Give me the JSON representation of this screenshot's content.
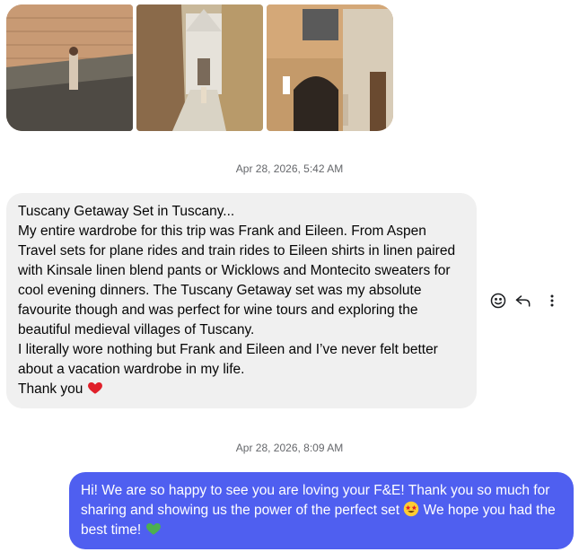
{
  "photos": [
    {
      "name": "photo-stone-wall",
      "alt_icon": "photo-icon"
    },
    {
      "name": "photo-alley-church",
      "alt_icon": "photo-icon"
    },
    {
      "name": "photo-archway-building",
      "alt_icon": "photo-icon"
    }
  ],
  "timestamps": {
    "first": "Apr 28, 2026, 5:42 AM",
    "second": "Apr 28, 2026, 8:09 AM"
  },
  "incoming_message": {
    "line_title": "Tuscany Getaway Set in Tuscany...",
    "paragraph_1": "My entire wardrobe for this trip was Frank and Eileen. From Aspen Travel sets for plane rides and train rides to Eileen shirts in linen paired with Kinsale linen blend pants or Wicklows and Montecito sweaters for cool evening dinners. The Tuscany Getaway set was my absolute favourite though and was perfect for wine tours and exploring the beautiful medieval villages of Tuscany.",
    "paragraph_2": "I literally wore nothing but Frank and Eileen and I’ve never felt better about a vacation wardrobe in my life.",
    "thanks": "Thank you",
    "thanks_emoji": "red-heart-icon"
  },
  "message_actions": {
    "react_icon": "smiley-icon",
    "reply_icon": "reply-arrow-icon",
    "more_icon": "more-vertical-icon"
  },
  "outgoing_message": {
    "text_part_1": "Hi! We are so happy to see you are loving your F&E! Thank you so much for sharing and showing us the power of the perfect set",
    "emoji_1": "star-struck-icon",
    "text_part_2": "We hope you had the best time!",
    "emoji_2": "green-heart-icon"
  },
  "colors": {
    "incoming_bubble": "#f0f0f0",
    "outgoing_bubble": "#4f5ff0",
    "timestamp": "#65676b"
  }
}
